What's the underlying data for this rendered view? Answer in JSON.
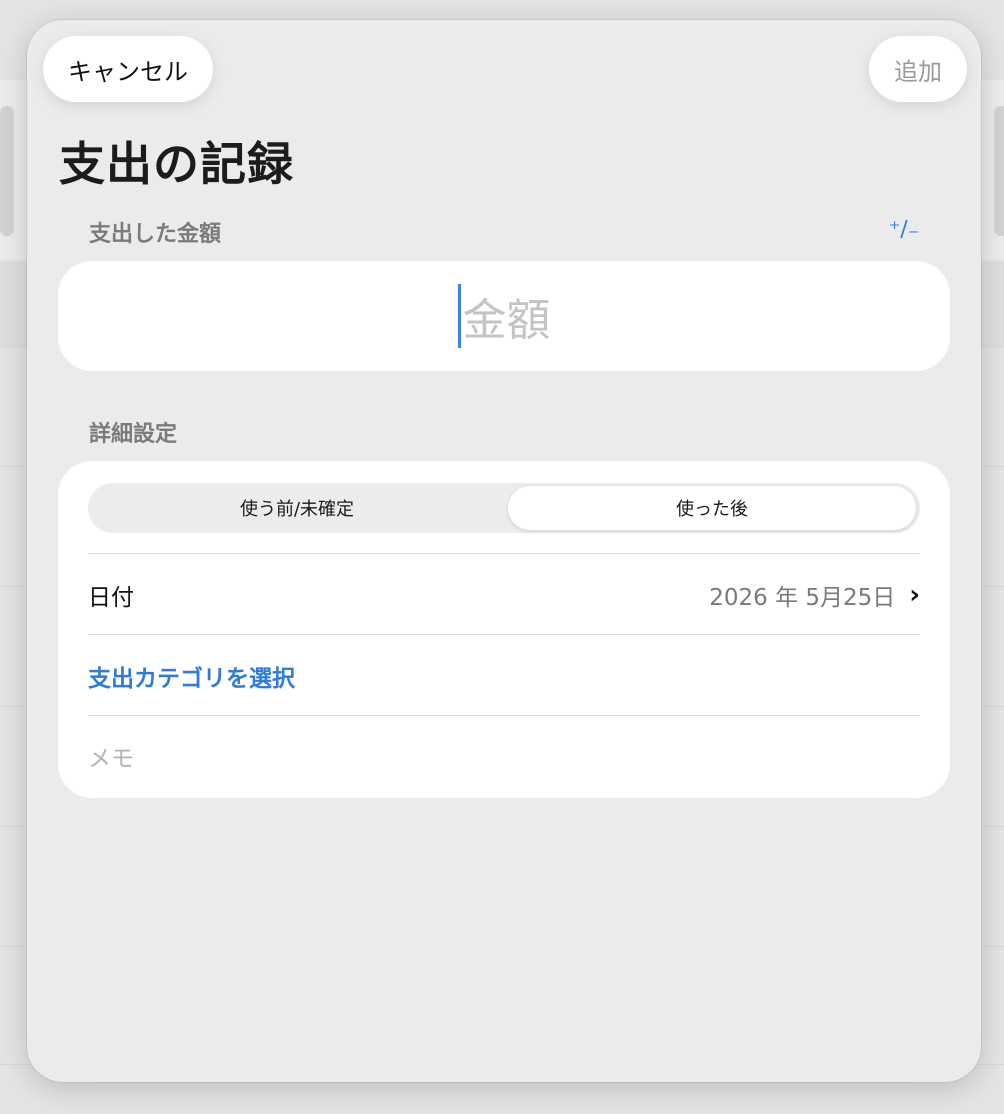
{
  "header": {
    "cancel_label": "キャンセル",
    "add_label": "追加",
    "title": "支出の記録"
  },
  "amount_section": {
    "label": "支出した金額",
    "sign_toggle_icon": "plus-minus-icon",
    "sign_toggle_glyph": "⁺∕₋",
    "placeholder": "金額",
    "value": ""
  },
  "details": {
    "label": "詳細設定",
    "segments": [
      {
        "label": "使う前/未確定",
        "selected": false
      },
      {
        "label": "使った後",
        "selected": true
      }
    ],
    "date_label": "日付",
    "date_value": "2026 年 5月25日",
    "chevron_glyph": "›",
    "category_label": "支出カテゴリを選択",
    "memo_placeholder": "メモ"
  },
  "colors": {
    "accent": "#2f7bdc",
    "caret": "#3b82f6",
    "sheet_background": "#ebebeb"
  }
}
